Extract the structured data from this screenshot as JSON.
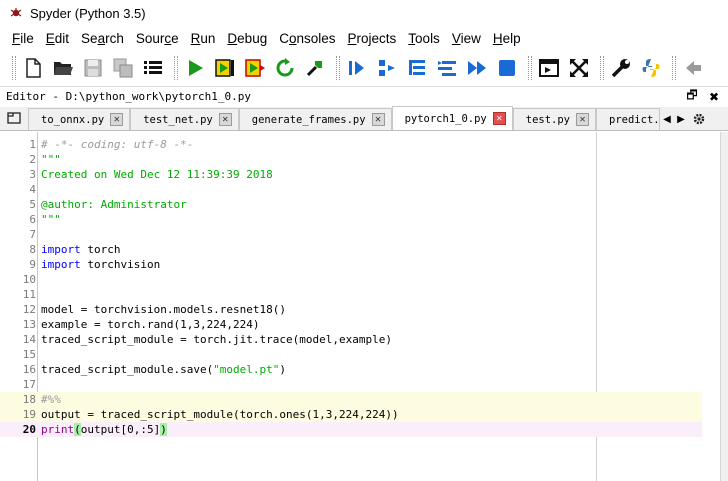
{
  "window": {
    "title": "Spyder (Python 3.5)"
  },
  "menu": [
    {
      "pre": "",
      "ul": "F",
      "post": "ile"
    },
    {
      "pre": "",
      "ul": "E",
      "post": "dit"
    },
    {
      "pre": "Se",
      "ul": "a",
      "post": "rch"
    },
    {
      "pre": "Sour",
      "ul": "c",
      "post": "e"
    },
    {
      "pre": "",
      "ul": "R",
      "post": "un"
    },
    {
      "pre": "",
      "ul": "D",
      "post": "ebug"
    },
    {
      "pre": "C",
      "ul": "o",
      "post": "nsoles"
    },
    {
      "pre": "",
      "ul": "P",
      "post": "rojects"
    },
    {
      "pre": "",
      "ul": "T",
      "post": "ools"
    },
    {
      "pre": "",
      "ul": "V",
      "post": "iew"
    },
    {
      "pre": "",
      "ul": "H",
      "post": "elp"
    }
  ],
  "toolbar": {
    "icons": [
      "new-file-icon",
      "open-folder-icon",
      "save-icon",
      "save-all-icon",
      "list-icon",
      "run-icon",
      "run-cell-icon",
      "run-cell-advance-icon",
      "rerun-icon",
      "configure-run-icon",
      "debug-icon",
      "step-icon",
      "step-into-icon",
      "step-return-icon",
      "continue-icon",
      "stop-icon",
      "maximize-pane-icon",
      "fullscreen-icon",
      "preferences-wrench-icon",
      "python-path-icon",
      "back-arrow-icon"
    ]
  },
  "editor_pane": {
    "title": "Editor - D:\\python_work\\pytorch1_0.py",
    "undock_glyph": "🗗",
    "close_glyph": "✖"
  },
  "tabs": [
    {
      "name": "to_onnx.py",
      "active": false
    },
    {
      "name": "test_net.py",
      "active": false
    },
    {
      "name": "generate_frames.py",
      "active": false
    },
    {
      "name": "pytorch1_0.py",
      "active": true
    },
    {
      "name": "test.py",
      "active": false
    },
    {
      "name": "predict.",
      "active": false
    }
  ],
  "code_lines": [
    {
      "n": "1",
      "parts": [
        [
          "c-comment",
          "# -*- coding: utf-8 -*-"
        ]
      ]
    },
    {
      "n": "2",
      "parts": [
        [
          "c-green",
          "\"\"\""
        ]
      ]
    },
    {
      "n": "3",
      "parts": [
        [
          "c-green",
          "Created on Wed Dec 12 11:39:39 2018"
        ]
      ]
    },
    {
      "n": "4",
      "parts": []
    },
    {
      "n": "5",
      "parts": [
        [
          "c-green",
          "@author: Administrator"
        ]
      ]
    },
    {
      "n": "6",
      "parts": [
        [
          "c-green",
          "\"\"\""
        ]
      ]
    },
    {
      "n": "7",
      "parts": []
    },
    {
      "n": "8",
      "parts": [
        [
          "c-kw",
          "import"
        ],
        [
          "c-def",
          " torch"
        ]
      ]
    },
    {
      "n": "9",
      "parts": [
        [
          "c-kw",
          "import"
        ],
        [
          "c-def",
          " torchvision"
        ]
      ]
    },
    {
      "n": "10",
      "parts": []
    },
    {
      "n": "11",
      "parts": []
    },
    {
      "n": "12",
      "parts": [
        [
          "c-def",
          "model = torchvision.models.resnet18()"
        ]
      ]
    },
    {
      "n": "13",
      "parts": [
        [
          "c-def",
          "example = torch.rand(1,3,224,224)"
        ]
      ]
    },
    {
      "n": "14",
      "parts": [
        [
          "c-def",
          "traced_script_module = torch.jit.trace(model,example)"
        ]
      ]
    },
    {
      "n": "15",
      "parts": []
    },
    {
      "n": "16",
      "parts": [
        [
          "c-def",
          "traced_script_module.save("
        ],
        [
          "c-str",
          "\"model.pt\""
        ],
        [
          "c-def",
          ")"
        ]
      ]
    },
    {
      "n": "17",
      "parts": []
    },
    {
      "n": "18",
      "parts": [
        [
          "c-cellmark",
          "#%%"
        ]
      ],
      "cell": true
    },
    {
      "n": "19",
      "parts": [
        [
          "c-def",
          "output = traced_script_module(torch.ones(1,3,224,224))"
        ]
      ],
      "cell": true
    },
    {
      "n": "20",
      "parts": [
        [
          "c-builtin",
          "print"
        ],
        [
          "c-brace",
          "("
        ],
        [
          "c-def",
          "output[0,:5]"
        ],
        [
          "c-brace",
          ")"
        ]
      ],
      "current": true
    }
  ]
}
